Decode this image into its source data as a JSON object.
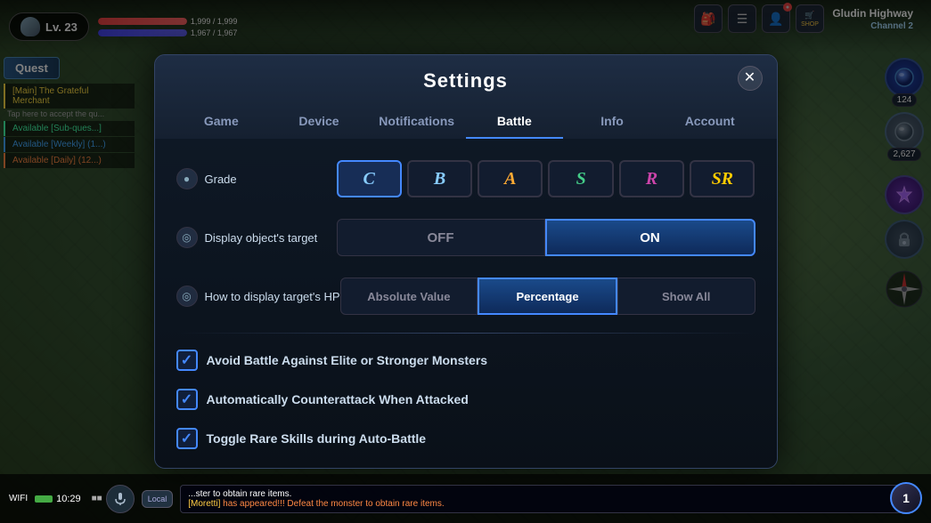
{
  "game": {
    "background_color": "#3a5a3a",
    "player": {
      "level": "Lv. 23",
      "hp": "1,999 / 1,999",
      "mp": "1,967 / 1,967"
    },
    "location": "Gludin Highway",
    "channel": "Channel 2"
  },
  "top_icons": [
    {
      "id": "icon1",
      "symbol": "🎒"
    },
    {
      "id": "icon2",
      "symbol": "☰"
    },
    {
      "id": "icon3",
      "symbol": "👤"
    },
    {
      "id": "icon4",
      "symbol": "🛒",
      "label": "SHOP"
    }
  ],
  "quest_panel": {
    "button_label": "Quest",
    "items": [
      {
        "text": "[Main] The Grateful Merchant",
        "type": "main"
      },
      {
        "tap_text": "Tap here to accept the qu..."
      },
      {
        "text": "Available [Sub-ques...]",
        "type": "sub"
      },
      {
        "text": "Available [Weekly] (1...)",
        "type": "weekly"
      },
      {
        "text": "Available [Daily] (12...)",
        "type": "daily"
      }
    ]
  },
  "modal": {
    "title": "Settings",
    "close_label": "✕",
    "tabs": [
      {
        "id": "game",
        "label": "Game",
        "active": false
      },
      {
        "id": "device",
        "label": "Device",
        "active": false
      },
      {
        "id": "notifications",
        "label": "Notifications",
        "active": false
      },
      {
        "id": "battle",
        "label": "Battle",
        "active": true
      },
      {
        "id": "info",
        "label": "Info",
        "active": false
      },
      {
        "id": "account",
        "label": "Account",
        "active": false
      }
    ],
    "settings": {
      "grade": {
        "label": "Grade",
        "icon": "●",
        "options": [
          {
            "id": "c",
            "symbol": "C",
            "selected": true,
            "color": "#88ccff"
          },
          {
            "id": "b",
            "symbol": "B",
            "color": "#88ccff"
          },
          {
            "id": "a",
            "symbol": "A",
            "color": "#ffaa33"
          },
          {
            "id": "s",
            "symbol": "S",
            "color": "#44cc88"
          },
          {
            "id": "r",
            "symbol": "R",
            "color": "#cc44aa"
          },
          {
            "id": "sr",
            "symbol": "SR",
            "color": "#ffcc00"
          }
        ]
      },
      "display_object_target": {
        "label": "Display object's target",
        "icon": "◎",
        "off_label": "OFF",
        "on_label": "ON",
        "value": "on"
      },
      "target_hp_display": {
        "label": "How to display target's HP",
        "icon": "◎",
        "options": [
          {
            "id": "absolute",
            "label": "Absolute Value"
          },
          {
            "id": "percentage",
            "label": "Percentage",
            "selected": true
          },
          {
            "id": "all",
            "label": "Show All"
          }
        ]
      },
      "checkboxes": [
        {
          "id": "avoid-elite",
          "label": "Avoid Battle Against Elite or Stronger Monsters",
          "checked": true
        },
        {
          "id": "counterattack",
          "label": "Automatically Counterattack When Attacked",
          "checked": true
        },
        {
          "id": "rare-skills",
          "label": "Toggle Rare Skills during Auto-Battle",
          "checked": true
        }
      ]
    }
  },
  "right_panel": {
    "items": [
      {
        "id": "orb1",
        "color": "#2244aa",
        "count": "124"
      },
      {
        "id": "orb2",
        "color": "#6633aa",
        "count": "2,627"
      }
    ]
  },
  "bottom_bar": {
    "wifi_label": "WIFI",
    "time_label": "10:29",
    "local_label": "Local",
    "chat_messages": [
      "[Moretti] has appeared!!! Defeat the monster to obtain rare items.",
      "...ster to obtain rare items."
    ]
  },
  "bottom_right_number": "1"
}
